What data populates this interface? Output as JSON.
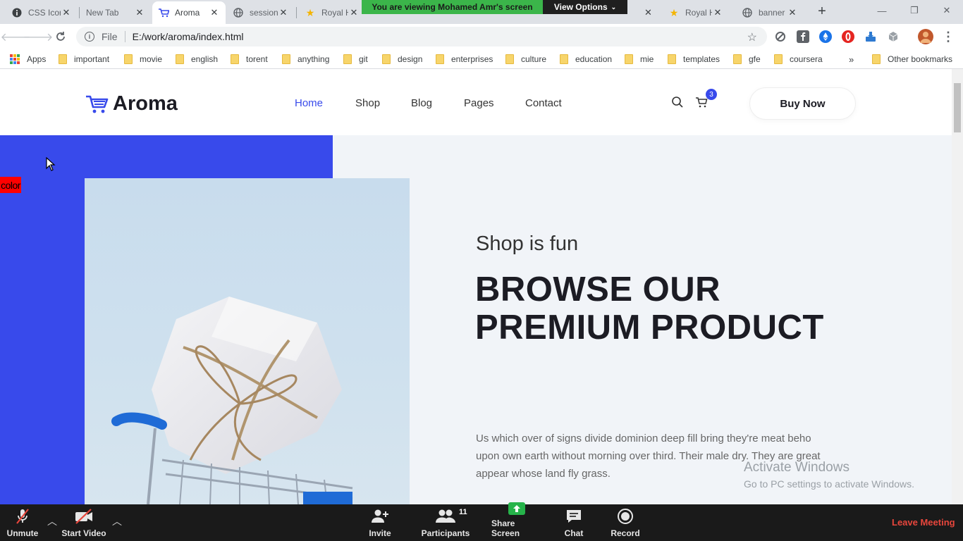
{
  "browser": {
    "tabs": [
      {
        "title": "CSS Icons",
        "favicon": "info-icon"
      },
      {
        "title": "New Tab",
        "favicon": "none"
      },
      {
        "title": "Aroma",
        "favicon": "cart-logo-icon",
        "active": true
      },
      {
        "title": "session",
        "favicon": "globe-icon"
      },
      {
        "title": "Royal H",
        "favicon": "star-icon"
      },
      {
        "title": "Royal H",
        "favicon": "star-icon"
      },
      {
        "title": "banner",
        "favicon": "globe-icon"
      }
    ],
    "new_tab_glyph": "+",
    "screen_share_banner": "You are viewing Mohamed Amr's screen",
    "view_options_label": "View Options",
    "address": {
      "scheme_label": "File",
      "url": "E:/work/aroma/index.html"
    },
    "bookmarks": [
      {
        "label": "Apps",
        "type": "apps"
      },
      {
        "label": "important"
      },
      {
        "label": "movie"
      },
      {
        "label": "english"
      },
      {
        "label": "torent"
      },
      {
        "label": "anything"
      },
      {
        "label": "git"
      },
      {
        "label": "design"
      },
      {
        "label": "enterprises"
      },
      {
        "label": "culture"
      },
      {
        "label": "education"
      },
      {
        "label": "mie"
      },
      {
        "label": "templates"
      },
      {
        "label": "gfe"
      },
      {
        "label": "coursera"
      }
    ],
    "bookmarks_overflow": "»",
    "other_bookmarks": "Other bookmarks"
  },
  "site": {
    "logo_text": "Aroma",
    "nav": [
      {
        "label": "Home",
        "active": true
      },
      {
        "label": "Shop"
      },
      {
        "label": "Blog"
      },
      {
        "label": "Pages"
      },
      {
        "label": "Contact"
      }
    ],
    "cart_count": "3",
    "buy_now_label": "Buy Now",
    "accent_color": "#384aeb",
    "color_label": "color",
    "hero": {
      "subtitle": "Shop is fun",
      "title_line1": "BROWSE OUR",
      "title_line2": "PREMIUM PRODUCT",
      "description": "Us which over of signs divide dominion deep fill bring they're meat beho upon own earth without morning over third. Their male dry. They are great appear whose land fly grass."
    }
  },
  "watermark": {
    "line1": "Activate Windows",
    "line2": "Go to PC settings to activate Windows."
  },
  "zoom": {
    "unmute_label": "Unmute",
    "start_video_label": "Start Video",
    "invite_label": "Invite",
    "participants_label": "Participants",
    "participants_count": "11",
    "share_screen_label": "Share Screen",
    "chat_label": "Chat",
    "record_label": "Record",
    "leave_label": "Leave Meeting"
  }
}
